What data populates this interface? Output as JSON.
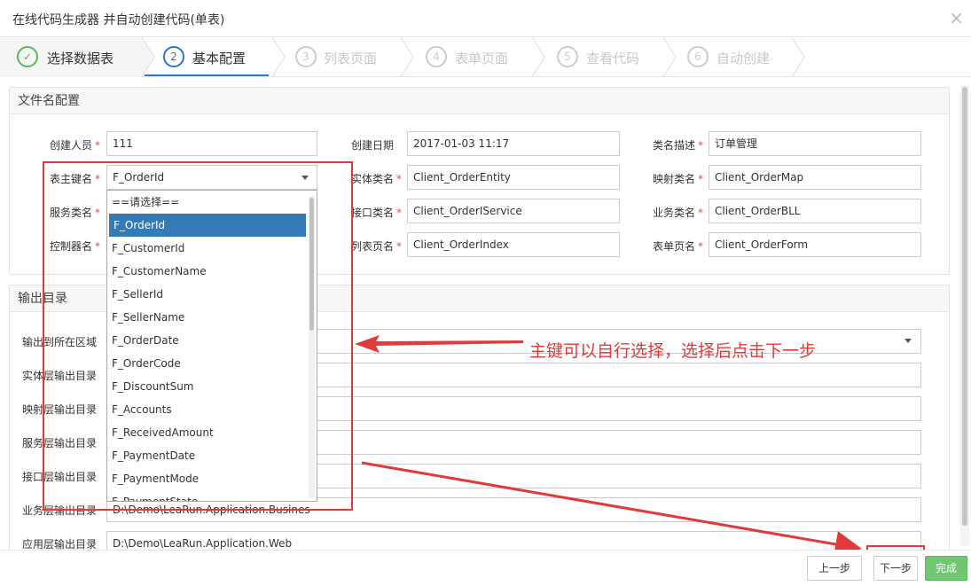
{
  "window": {
    "title": "在线代码生成器 并自动创建代码(单表)",
    "close_glyph": "×"
  },
  "steps": [
    {
      "num": "✓",
      "label": "选择数据表",
      "state": "done"
    },
    {
      "num": "2",
      "label": "基本配置",
      "state": "active"
    },
    {
      "num": "3",
      "label": "列表页面",
      "state": "todo"
    },
    {
      "num": "4",
      "label": "表单页面",
      "state": "todo"
    },
    {
      "num": "5",
      "label": "查看代码",
      "state": "todo"
    },
    {
      "num": "6",
      "label": "自动创建",
      "state": "todo"
    }
  ],
  "file_config": {
    "header": "文件名配置",
    "creator": {
      "label": "创建人员",
      "value": "111"
    },
    "create_date": {
      "label": "创建日期",
      "value": "2017-01-03 11:17"
    },
    "class_desc": {
      "label": "类名描述",
      "value": "订单管理"
    },
    "primary_key": {
      "label": "表主键名",
      "value": "F_OrderId"
    },
    "entity_class": {
      "label": "实体类名",
      "value": "Client_OrderEntity"
    },
    "map_class": {
      "label": "映射类名",
      "value": "Client_OrderMap"
    },
    "service_class": {
      "label": "服务类名"
    },
    "interface_class": {
      "label": "接口类名",
      "value": "Client_OrderIService"
    },
    "business_class": {
      "label": "业务类名",
      "value": "Client_OrderBLL"
    },
    "controller_name": {
      "label": "控制器名"
    },
    "list_page": {
      "label": "列表页名",
      "value": "Client_OrderIndex"
    },
    "form_page": {
      "label": "表单页名",
      "value": "Client_OrderForm"
    },
    "required_mark": "*"
  },
  "output_dir": {
    "header": "输出目录",
    "area": {
      "label": "输出到所在区域"
    },
    "entity_dir": {
      "label": "实体层输出目录"
    },
    "map_dir": {
      "label": "映射层输出目录"
    },
    "service_dir": {
      "label": "服务层输出目录"
    },
    "interface_dir": {
      "label": "接口层输出目录"
    },
    "business_dir": {
      "label": "业务层输出目录",
      "value": "D:\\Demo\\LeaRun.Application.Busines"
    },
    "app_dir": {
      "label": "应用层输出目录",
      "value": "D:\\Demo\\LeaRun.Application.Web"
    }
  },
  "dropdown_options": [
    "==请选择==",
    "F_OrderId",
    "F_CustomerId",
    "F_CustomerName",
    "F_SellerId",
    "F_SellerName",
    "F_OrderDate",
    "F_OrderCode",
    "F_DiscountSum",
    "F_Accounts",
    "F_ReceivedAmount",
    "F_PaymentDate",
    "F_PaymentMode",
    "F_PaymentState"
  ],
  "dropdown_selected_index": 1,
  "annotation": "主键可以自行选择，选择后点击下一步",
  "footer": {
    "prev": "上一步",
    "next": "下一步",
    "finish": "完成"
  },
  "colors": {
    "accent": "#2a78c9",
    "done": "#5cb85c",
    "annotation": "#e03a3a",
    "selected": "#337ab7"
  }
}
